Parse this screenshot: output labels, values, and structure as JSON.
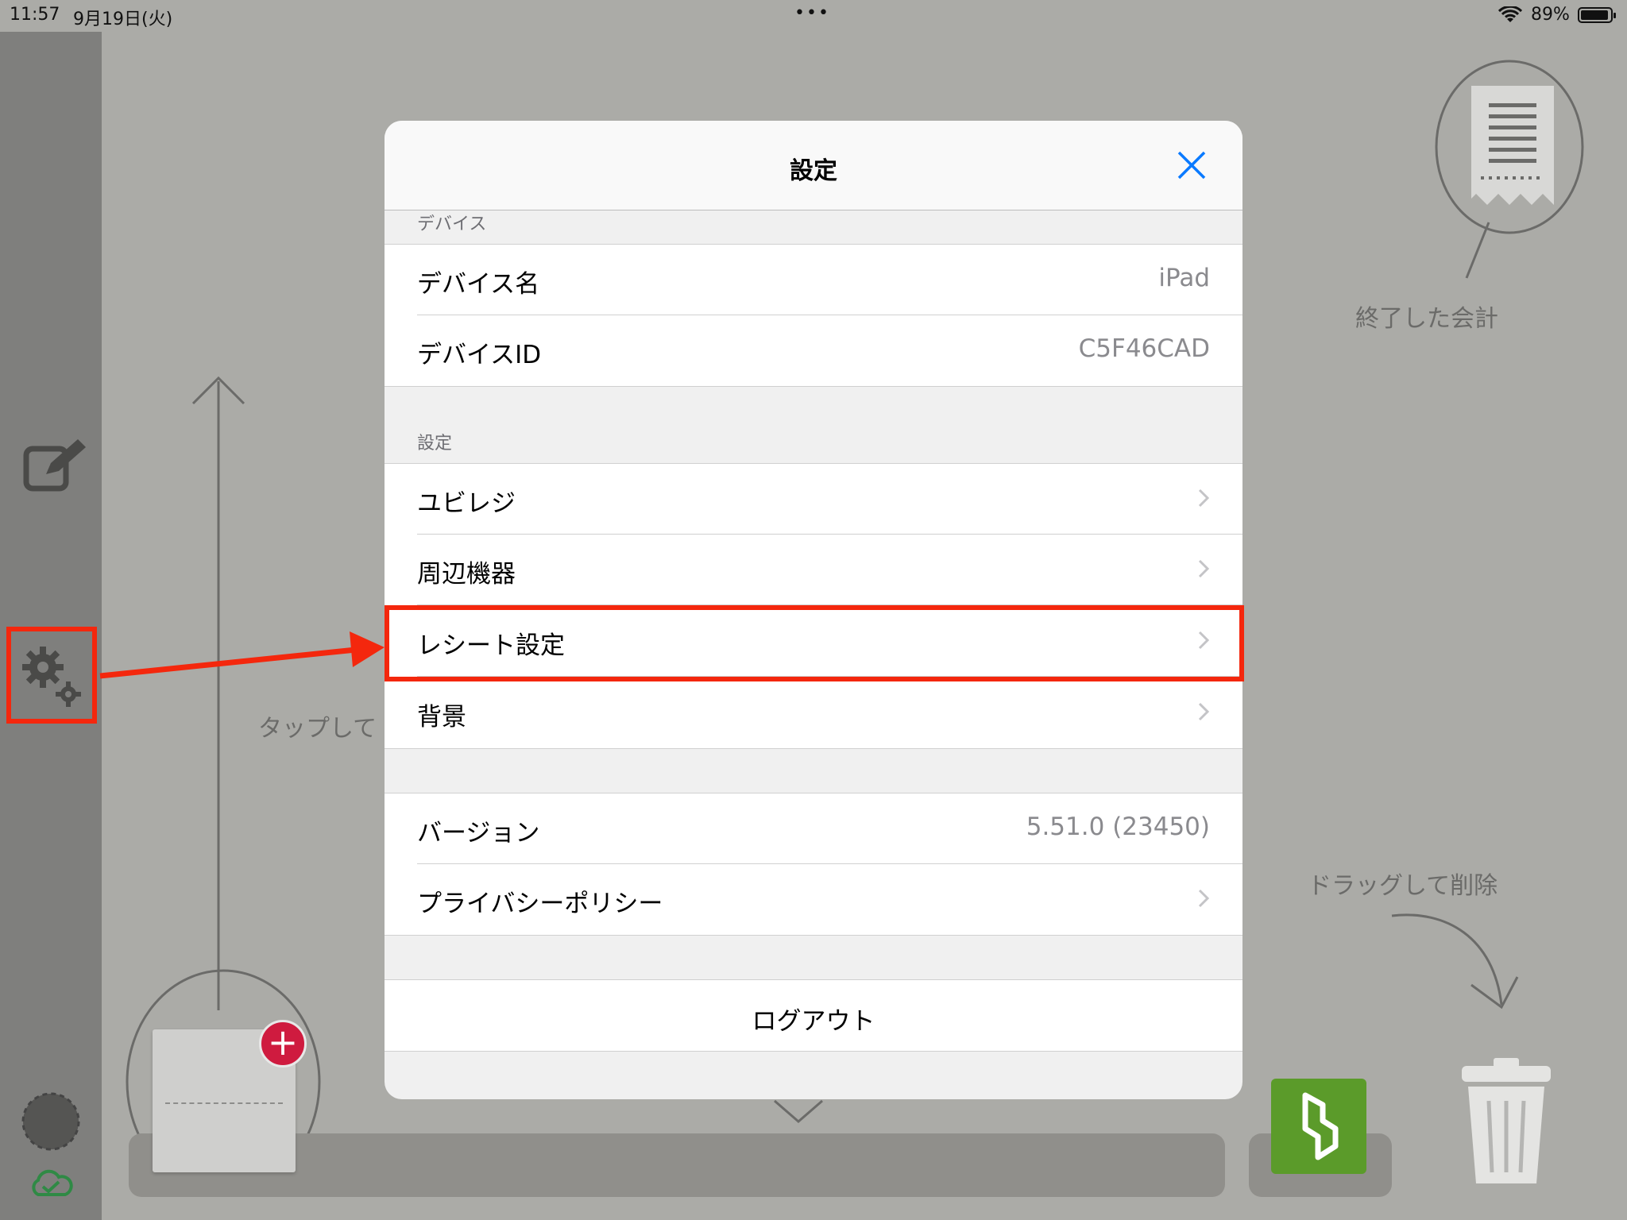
{
  "status_bar": {
    "time": "11:57",
    "date": "9月19日(火)",
    "dots": "•••",
    "battery": "89%"
  },
  "background": {
    "finished_label": "終了した会計",
    "tap_hint": "タップして",
    "drag_delete_label": "ドラッグして削除"
  },
  "modal": {
    "title": "設定",
    "section_device": "デバイス",
    "device_name_label": "デバイス名",
    "device_name_value": "iPad",
    "device_id_label": "デバイスID",
    "device_id_value": "C5F46CAD",
    "section_settings": "設定",
    "items": [
      {
        "label": "ユビレジ"
      },
      {
        "label": "周辺機器"
      },
      {
        "label": "レシート設定"
      },
      {
        "label": "背景"
      }
    ],
    "version_label": "バージョン",
    "version_value": "5.51.0 (23450)",
    "privacy_label": "プライバシーポリシー",
    "logout_label": "ログアウト"
  },
  "colors": {
    "accent": "#0a7aff",
    "highlight": "#f4270d",
    "badge": "#cf1b3f",
    "tile": "#5b9b2a"
  }
}
